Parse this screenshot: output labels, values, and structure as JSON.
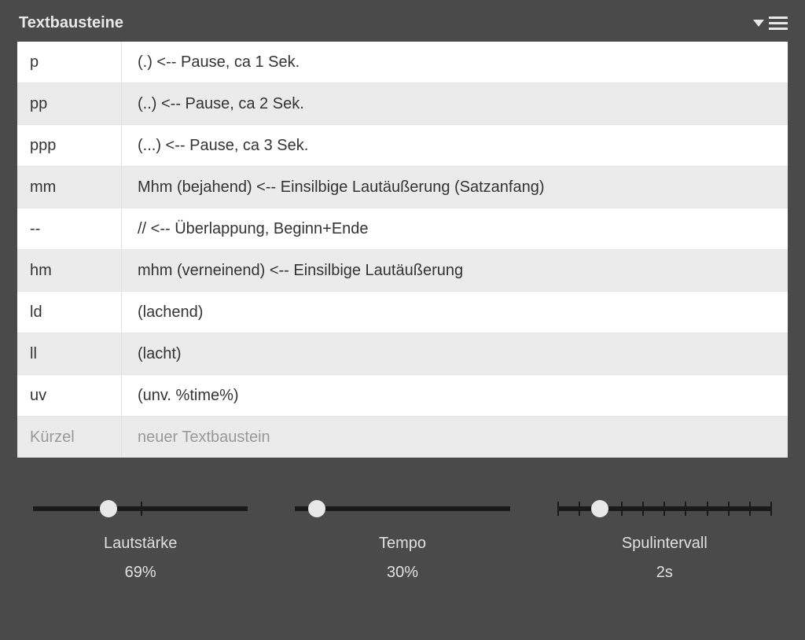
{
  "panel": {
    "title": "Textbausteine"
  },
  "rows": [
    {
      "key": "p",
      "value": "(.) <-- Pause, ca 1 Sek."
    },
    {
      "key": "pp",
      "value": "(..) <-- Pause, ca 2 Sek."
    },
    {
      "key": "ppp",
      "value": "(...) <-- Pause, ca 3 Sek."
    },
    {
      "key": "mm",
      "value": "Mhm (bejahend) <-- Einsilbige Lautäußerung (Satzanfang)"
    },
    {
      "key": "--",
      "value": "// <-- Überlappung, Beginn+Ende"
    },
    {
      "key": "hm",
      "value": "mhm (verneinend) <-- Einsilbige Lautäußerung"
    },
    {
      "key": "ld",
      "value": "(lachend)"
    },
    {
      "key": "ll",
      "value": "(lacht)"
    },
    {
      "key": "uv",
      "value": "(unv. %time%)"
    }
  ],
  "inputs": {
    "key_placeholder": "Kürzel",
    "value_placeholder": "neuer Textbaustein"
  },
  "sliders": {
    "volume": {
      "label": "Lautstärke",
      "value": "69%",
      "percent": 35,
      "ticks": 2
    },
    "tempo": {
      "label": "Tempo",
      "value": "30%",
      "percent": 10,
      "ticks": 0
    },
    "interval": {
      "label": "Spulintervall",
      "value": "2s",
      "percent": 20,
      "ticks": 11
    }
  }
}
